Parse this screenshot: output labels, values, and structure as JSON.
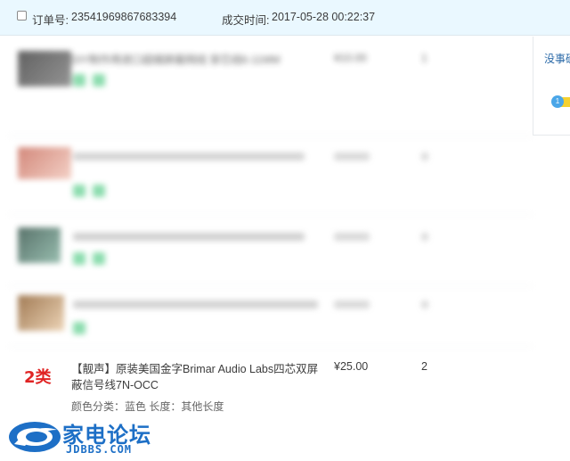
{
  "order": {
    "order_no_label": "订单号:",
    "order_no": "23541969867683394",
    "deal_time_label": "成交时间:",
    "deal_time": "2017-05-28 00:22:37"
  },
  "items": [
    {
      "title": "DIY制作用进口超细屏蔽网线 穿芯线6-11MM",
      "price": "¥10.00",
      "qty": "1"
    },
    {
      "title": "",
      "price": "",
      "qty": ""
    },
    {
      "title": "",
      "price": "",
      "qty": ""
    },
    {
      "title": "",
      "price": "",
      "qty": ""
    }
  ],
  "last_item": {
    "badge": "2类",
    "title": "【靓声】原装美国金字Brimar Audio Labs四芯双屏蔽信号线7N-OCC",
    "sku": "颜色分类：蓝色  长度：其他长度",
    "price": "¥25.00",
    "qty": "2"
  },
  "right_panel": {
    "note": "没事确"
  },
  "watermark": {
    "text": "家电论坛",
    "domain": "JDBBS.COM"
  }
}
